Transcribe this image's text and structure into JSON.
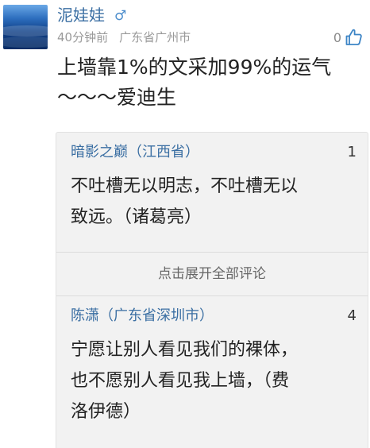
{
  "post": {
    "username": "泥娃娃",
    "gender_symbol": "♂",
    "time": "40分钟前",
    "location": "广东省广州市",
    "like_count": "0",
    "like_icon": "thumbs-up-icon",
    "text_line1": "上墙靠1%的文采加99%的运气",
    "text_line2": "～～～爱迪生"
  },
  "comments": [
    {
      "author": "暗影之巅（江西省）",
      "like_count": "1",
      "text_line1": "不吐槽无以明志，不吐槽无以",
      "text_line2": "致远。（诸葛亮）"
    },
    {
      "author": "陈潇（广东省深圳市）",
      "like_count": "4",
      "text_line1": "宁愿让别人看见我们的裸体，",
      "text_line2": "也不愿别人看见我上墙，（费",
      "text_line3": "洛伊德）"
    }
  ],
  "expand_label": "点击展开全部评论",
  "colors": {
    "username": "#3b6fa3",
    "meta": "#9a9a9a",
    "comment_bg": "#f2f2f2",
    "like_icon": "#3d85c6"
  }
}
